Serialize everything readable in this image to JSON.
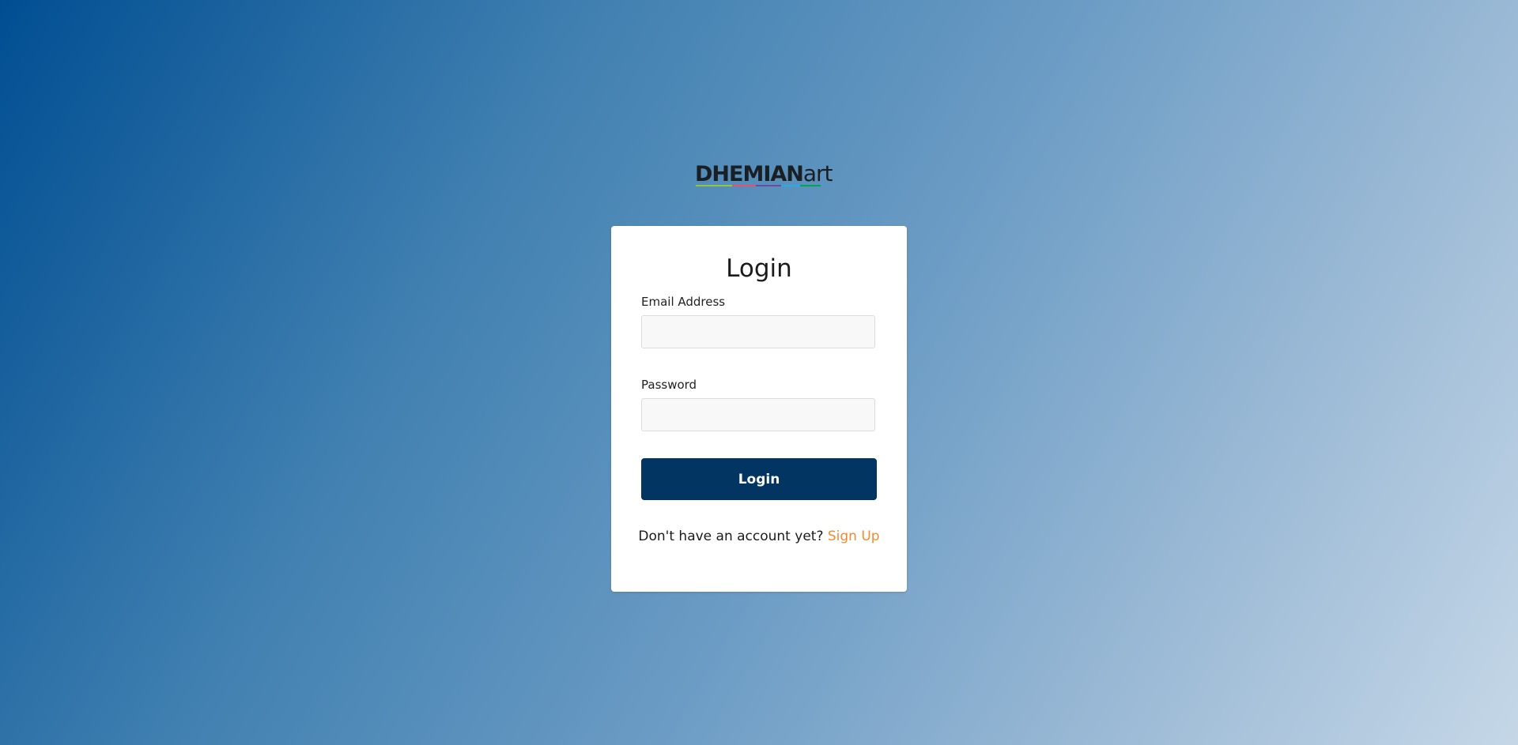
{
  "brand": {
    "logo_bold": "DHEMIAN",
    "logo_light": "art",
    "underline_colors": [
      "#8dc63f",
      "#e94e77",
      "#6d4c9f",
      "#29abe2",
      "#00a651"
    ]
  },
  "login_form": {
    "title": "Login",
    "email_label": "Email Address",
    "email_value": "",
    "password_label": "Password",
    "password_value": "",
    "submit_label": "Login",
    "signup_prompt": "Don't have an account yet?",
    "signup_link": "Sign Up"
  },
  "colors": {
    "button_bg": "#023561",
    "link": "#f58a2e",
    "gradient_start": "#004e92",
    "gradient_end": "#c5d7e7"
  }
}
